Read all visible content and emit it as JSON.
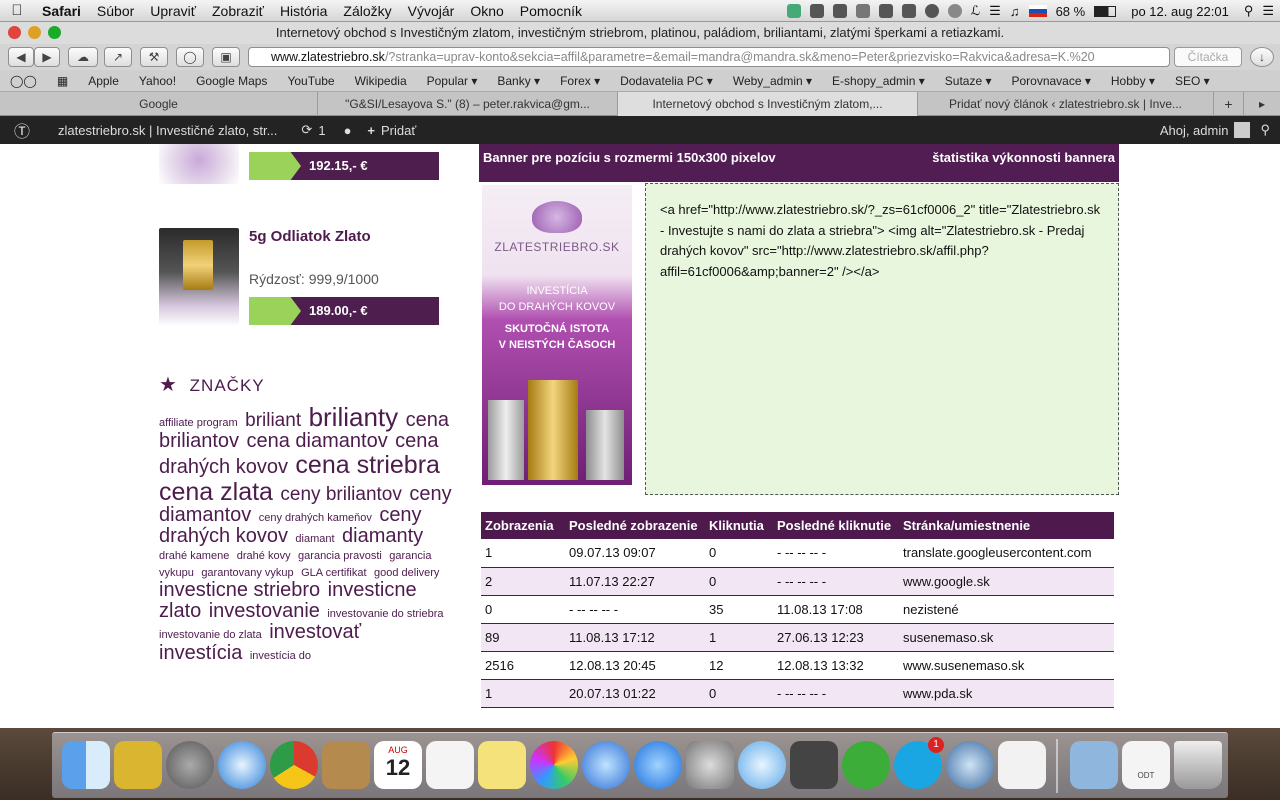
{
  "menubar": {
    "apple": "",
    "items": [
      "Safari",
      "Súbor",
      "Upraviť",
      "Zobraziť",
      "História",
      "Záložky",
      "Vývojár",
      "Okno",
      "Pomocník"
    ],
    "battery": "68 %",
    "clock": "po 12. aug  22:01"
  },
  "window_title": "Internetový obchod s Investičným zlatom, investičným striebrom, platinou, paládiom, briliantami, zlatými šperkami a retiazkami.",
  "toolbar": {
    "url_host": "www.zlatestriebro.sk",
    "url_rest": "/?stranka=uprav-konto&sekcia=affil&parametre=&email=mandra@mandra.sk&meno=Peter&priezvisko=Rakvica&adresa=K.%20",
    "reader": "Čítačka"
  },
  "bookmarks": [
    "Apple",
    "Yahoo!",
    "Google Maps",
    "YouTube",
    "Wikipedia",
    "Popular ▾",
    "Banky ▾",
    "Forex ▾",
    "Dodavatelia PC ▾",
    "Weby_admin ▾",
    "E-shopy_admin ▾",
    "Sutaze ▾",
    "Porovnavace ▾",
    "Hobby ▾",
    "SEO ▾"
  ],
  "tabs": [
    "Google",
    "\"G&SI/Lesayova S.\" (8) – peter.rakvica@gm...",
    "Internetový obchod s Investičným zlatom,...",
    "Pridať nový článok ‹ zlatestriebro.sk | Inve..."
  ],
  "wpbar": {
    "site": "zlatestriebro.sk | Investičné zlato, str...",
    "updates": "1",
    "add": "Pridať",
    "user": "Ahoj, admin"
  },
  "products": [
    {
      "price": "192.15,- €"
    },
    {
      "name": "5g Odliatok Zlato",
      "purity": "Rýdzosť: 999,9/1000",
      "price": "189.00,- €"
    }
  ],
  "tags_heading": "ZNAČKY",
  "tags": [
    {
      "t": "affiliate program",
      "s": 11
    },
    {
      "t": "briliant",
      "s": 19
    },
    {
      "t": "brilianty",
      "s": 26
    },
    {
      "t": "cena briliantov",
      "s": 20
    },
    {
      "t": "cena diamantov",
      "s": 20
    },
    {
      "t": "cena drahých kovov",
      "s": 20
    },
    {
      "t": "cena striebra",
      "s": 25
    },
    {
      "t": "cena zlata",
      "s": 25
    },
    {
      "t": "ceny briliantov",
      "s": 19
    },
    {
      "t": "ceny diamantov",
      "s": 20
    },
    {
      "t": "ceny drahých kameňov",
      "s": 11
    },
    {
      "t": "ceny drahých kovov",
      "s": 20
    },
    {
      "t": "diamant",
      "s": 11
    },
    {
      "t": "diamanty",
      "s": 20
    },
    {
      "t": "drahé kamene",
      "s": 11
    },
    {
      "t": "drahé kovy",
      "s": 11
    },
    {
      "t": "garancia pravosti",
      "s": 11
    },
    {
      "t": "garancia vykupu",
      "s": 11
    },
    {
      "t": "garantovany vykup",
      "s": 11
    },
    {
      "t": "GLA certifikat",
      "s": 11
    },
    {
      "t": "good delivery",
      "s": 11
    },
    {
      "t": "investicne striebro",
      "s": 20
    },
    {
      "t": "investicne zlato",
      "s": 20
    },
    {
      "t": "investovanie",
      "s": 20
    },
    {
      "t": "investovanie do striebra",
      "s": 11
    },
    {
      "t": "investovanie do zlata",
      "s": 11
    },
    {
      "t": "investovať",
      "s": 20
    },
    {
      "t": "investícia",
      "s": 20
    },
    {
      "t": "investícia do",
      "s": 11
    }
  ],
  "banner": {
    "heading": "Banner pre pozíciu s rozmermi 150x300 pixelov",
    "stats_link": "štatistika výkonnosti bannera",
    "logo_text": "ZLATESTRIEBRO.SK",
    "line1": "INVESTÍCIA",
    "line2": "DO DRAHÝCH KOVOV",
    "line3": "SKUTOČNÁ ISTOTA",
    "line4": "V NEISTÝCH ČASOCH",
    "code": "<a href=\"http://www.zlatestriebro.sk/?_zs=61cf0006_2\" title=\"Zlatestriebro.sk - Investujte s nami do zlata a striebra\"> <img alt=\"Zlatestriebro.sk - Predaj drahých kovov\" src=\"http://www.zlatestriebro.sk/affil.php?affil=61cf0006&amp;banner=2\" /></a>"
  },
  "stats": {
    "headers": [
      "Zobrazenia",
      "Posledné zobrazenie",
      "Kliknutia",
      "Posledné kliknutie",
      "Stránka/umiestnenie"
    ],
    "rows": [
      [
        "1",
        "09.07.13 09:07",
        "0",
        "- -- -- -- -",
        "translate.googleusercontent.com"
      ],
      [
        "2",
        "11.07.13 22:27",
        "0",
        "- -- -- -- -",
        "www.google.sk"
      ],
      [
        "0",
        "- -- -- -- -",
        "35",
        "11.08.13 17:08",
        "nezistené"
      ],
      [
        "89",
        "11.08.13 17:12",
        "1",
        "27.06.13 12:23",
        "susenemaso.sk"
      ],
      [
        "2516",
        "12.08.13 20:45",
        "12",
        "12.08.13 13:32",
        "www.susenemaso.sk"
      ],
      [
        "1",
        "20.07.13 01:22",
        "0",
        "- -- -- -- -",
        "www.pda.sk"
      ]
    ]
  },
  "dock": {
    "calendar_month": "AUG",
    "calendar_day": "12",
    "badge": "1",
    "odt": "ODT"
  }
}
